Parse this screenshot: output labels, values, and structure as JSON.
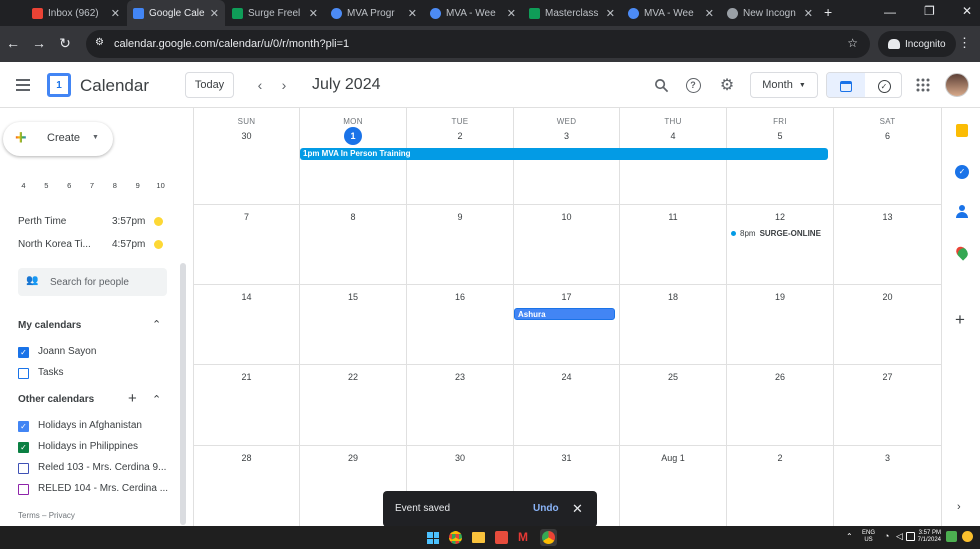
{
  "browser": {
    "tabs": [
      {
        "title": "Inbox (962)",
        "color": "#ea4335"
      },
      {
        "title": "Google Cale",
        "color": "#4285f4"
      },
      {
        "title": "Surge Freel",
        "color": "#0f9d58"
      },
      {
        "title": "MVA Progr",
        "color": "#4c8bf5"
      },
      {
        "title": "MVA - Wee",
        "color": "#4c8bf5"
      },
      {
        "title": "Masterclass",
        "color": "#0f9d58"
      },
      {
        "title": "MVA - Wee",
        "color": "#4c8bf5"
      },
      {
        "title": "New Incogn",
        "color": "#9aa0a6"
      }
    ],
    "url": "calendar.google.com/calendar/u/0/r/month?pli=1",
    "incognito_label": "Incognito"
  },
  "header": {
    "app_name": "Calendar",
    "logo_day": "1",
    "today_button": "Today",
    "current_period": "July 2024",
    "view_select": "Month"
  },
  "sidebar": {
    "create_label": "Create",
    "mini_cal_days": [
      "4",
      "5",
      "6",
      "7",
      "8",
      "9",
      "10"
    ],
    "world_clocks": [
      {
        "label": "Perth Time",
        "time": "3:57pm"
      },
      {
        "label": "North Korea Ti...",
        "time": "4:57pm"
      }
    ],
    "search_placeholder": "Search for people",
    "my_calendars_title": "My calendars",
    "my_calendars": [
      {
        "label": "Joann Sayon",
        "checked": true,
        "color": "#1a73e8"
      },
      {
        "label": "Tasks",
        "checked": false,
        "color": "#1a73e8"
      }
    ],
    "other_calendars_title": "Other calendars",
    "other_calendars": [
      {
        "label": "Holidays in Afghanistan",
        "checked": true,
        "color": "#4285f4"
      },
      {
        "label": "Holidays in Philippines",
        "checked": true,
        "color": "#0b8043"
      },
      {
        "label": "Reled 103 - Mrs. Cerdina 9...",
        "checked": false,
        "color": "#3f51b5"
      },
      {
        "label": "RELED 104 - Mrs. Cerdina ...",
        "checked": false,
        "color": "#8e24aa"
      }
    ],
    "footer_terms": "Terms",
    "footer_sep": "–",
    "footer_privacy": "Privacy"
  },
  "calendar": {
    "day_names": [
      "SUN",
      "MON",
      "TUE",
      "WED",
      "THU",
      "FRI",
      "SAT"
    ],
    "weeks": [
      [
        "30",
        "1",
        "2",
        "3",
        "4",
        "5",
        "6"
      ],
      [
        "7",
        "8",
        "9",
        "10",
        "11",
        "12",
        "13"
      ],
      [
        "14",
        "15",
        "16",
        "17",
        "18",
        "19",
        "20"
      ],
      [
        "21",
        "22",
        "23",
        "24",
        "25",
        "26",
        "27"
      ],
      [
        "28",
        "29",
        "30",
        "31",
        "Aug 1",
        "2",
        "3"
      ]
    ],
    "today_label": "1",
    "events": {
      "training": "1pm MVA In Person Training",
      "surge_time": "8pm",
      "surge_title": "SURGE-ONLINE",
      "ashura": "Ashura"
    }
  },
  "toast": {
    "message": "Event saved",
    "undo": "Undo"
  },
  "taskbar": {
    "lang_top": "ENG",
    "lang_bottom": "US",
    "time": "3:57 PM",
    "date": "7/1/2024"
  }
}
